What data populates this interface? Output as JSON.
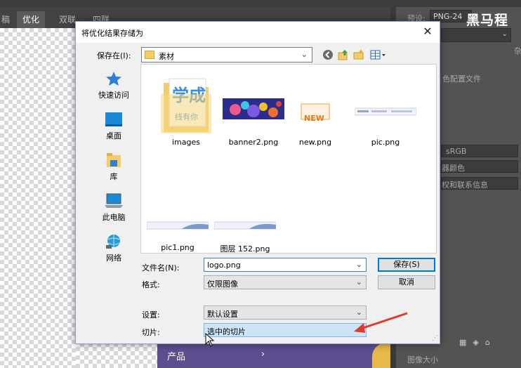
{
  "app": {
    "tabs": [
      "稿",
      "优化",
      "双联",
      "四联"
    ],
    "active_tab": 1,
    "right_panel": {
      "preset_label": "预设:",
      "preset_value": "PNG-24",
      "watermark": "黑马程",
      "text_1": "色配置文件",
      "text_2": "sRGB",
      "text_3": "器颜色",
      "text_4": "权和联系信息",
      "text_5": "图像大小",
      "partial_char": "杂"
    },
    "canvas": {
      "product_label": "产品",
      "arrow": "›"
    }
  },
  "dialog": {
    "title": "将优化结果存储为",
    "save_in_label": "保存在(I):",
    "current_folder": "素材",
    "places": [
      {
        "label": "快速访问",
        "icon": "star-icon"
      },
      {
        "label": "桌面",
        "icon": "desktop-icon"
      },
      {
        "label": "库",
        "icon": "library-icon"
      },
      {
        "label": "此电脑",
        "icon": "computer-icon"
      },
      {
        "label": "网络",
        "icon": "network-icon"
      }
    ],
    "files": [
      {
        "name": "images",
        "kind": "folder"
      },
      {
        "name": "banner2.png",
        "kind": "banner"
      },
      {
        "name": "new.png",
        "kind": "new"
      },
      {
        "name": "pic.png",
        "kind": "strip"
      },
      {
        "name": "pic1.png",
        "kind": "strip"
      },
      {
        "name": "图层 152.png",
        "kind": "strip"
      }
    ],
    "filename_label": "文件名(N):",
    "filename_value": "logo.png",
    "format_label": "格式:",
    "format_value": "仅限图像",
    "save_button": "保存(S)",
    "cancel_button": "取消",
    "settings_label": "设置:",
    "settings_value": "默认设置",
    "slices_label": "切片:",
    "slices_value": "选中的切片",
    "new_badge": "NEW"
  },
  "colors": {
    "accent": "#0078d7",
    "arrow_red": "#e03a2e",
    "folder_yellow": "#f5cc6a"
  }
}
